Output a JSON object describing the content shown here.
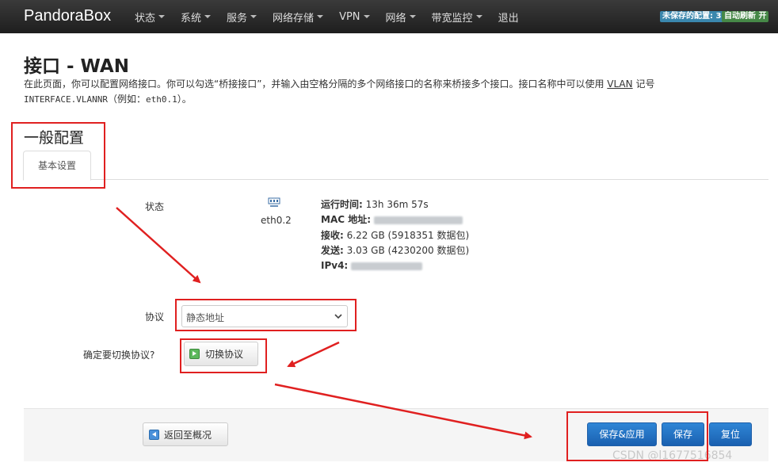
{
  "navbar": {
    "brand": "PandoraBox",
    "menu": [
      "状态",
      "系统",
      "服务",
      "网络存储",
      "VPN",
      "网络",
      "带宽监控",
      "退出"
    ],
    "badge_unsaved": "未保存的配置: 3",
    "badge_auto": "自动刷新 开"
  },
  "page": {
    "title": "接口 - WAN",
    "desc_part1": "在此页面，你可以配置网络接口。你可以勾选“桥接接口”，并输入由空格分隔的多个网络接口的名称来桥接多个接口。接口名称中可以使用 ",
    "desc_vlan": "VLAN",
    "desc_part2": " 记号",
    "desc_code": "INTERFACE.VLANNR",
    "desc_part3": "（例如：",
    "desc_example": "eth0.1",
    "desc_part4": "）。"
  },
  "section": {
    "title": "一般配置",
    "tab": "基本设置"
  },
  "status": {
    "label": "状态",
    "iface": "eth0.2",
    "uptime_label": "运行时间:",
    "uptime": "13h 36m 57s",
    "mac_label": "MAC 地址:",
    "rx_label": "接收:",
    "rx": "6.22 GB (5918351 数据包)",
    "tx_label": "发送:",
    "tx": "3.03 GB (4230200 数据包)",
    "ipv4_label": "IPv4:"
  },
  "protocol": {
    "label": "协议",
    "value": "静态地址"
  },
  "switch": {
    "label": "确定要切换协议?",
    "button": "切换协议"
  },
  "actions": {
    "back": "返回至概况",
    "save_apply": "保存&应用",
    "save": "保存",
    "reset": "复位"
  },
  "watermark": "CSDN @l1677516854",
  "colors": {
    "navbar": "#222222",
    "primary": "#2a74c4",
    "annotation": "#e02020"
  }
}
